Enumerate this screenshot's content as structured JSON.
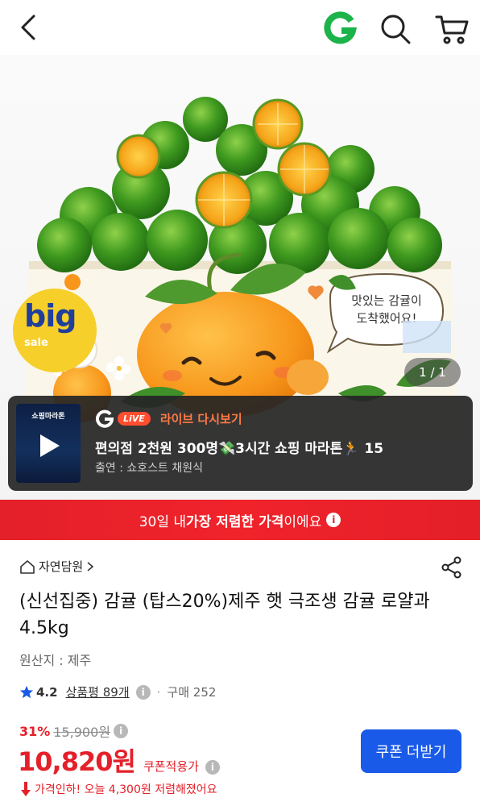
{
  "header": {
    "back_icon": "chevron-left-icon",
    "logo_icon": "gmarket-g-logo",
    "search_icon": "search-icon",
    "cart_icon": "cart-icon",
    "logo_color": "#1bb34a"
  },
  "hero": {
    "box_text": "맛있는 감귤이\n도착했어요!",
    "box_text_line1": "맛있는 감귤이",
    "box_text_line2": "도착했어요!",
    "badge_big": "big",
    "badge_sale": "sale",
    "page_indicator": "1 / 1"
  },
  "live": {
    "thumb_text": "쇼핑마라톤",
    "pill": "LiVE",
    "replay_label": "라이브 다시보기",
    "title": "편의점 2천원 300명💸3시간 쇼핑 마라톤🏃 15",
    "host": "출연 : 쇼호스트 채원식"
  },
  "banner": {
    "prefix": "30일 내 ",
    "highlight": "가장 저렴한 가격",
    "suffix": "이에요"
  },
  "product": {
    "store": "자연담원",
    "title": "(신선집중) 감귤 (탑스20%)제주 햇 극조생 감귤 로얄과 4.5kg",
    "origin": "원산지 : 제주",
    "rating": "4.2",
    "reviews": "상품평 89개",
    "purchases": "구매 252"
  },
  "price": {
    "discount": "31%",
    "original": "15,900원",
    "final": "10,820원",
    "coupon_note": "쿠폰적용가",
    "drop_note": "가격인하! 오늘 4,300원 저렴해졌어요",
    "coupon_button": "쿠폰 더받기"
  },
  "colors": {
    "accent_red": "#e4202a",
    "button_blue": "#1a5ae8"
  }
}
